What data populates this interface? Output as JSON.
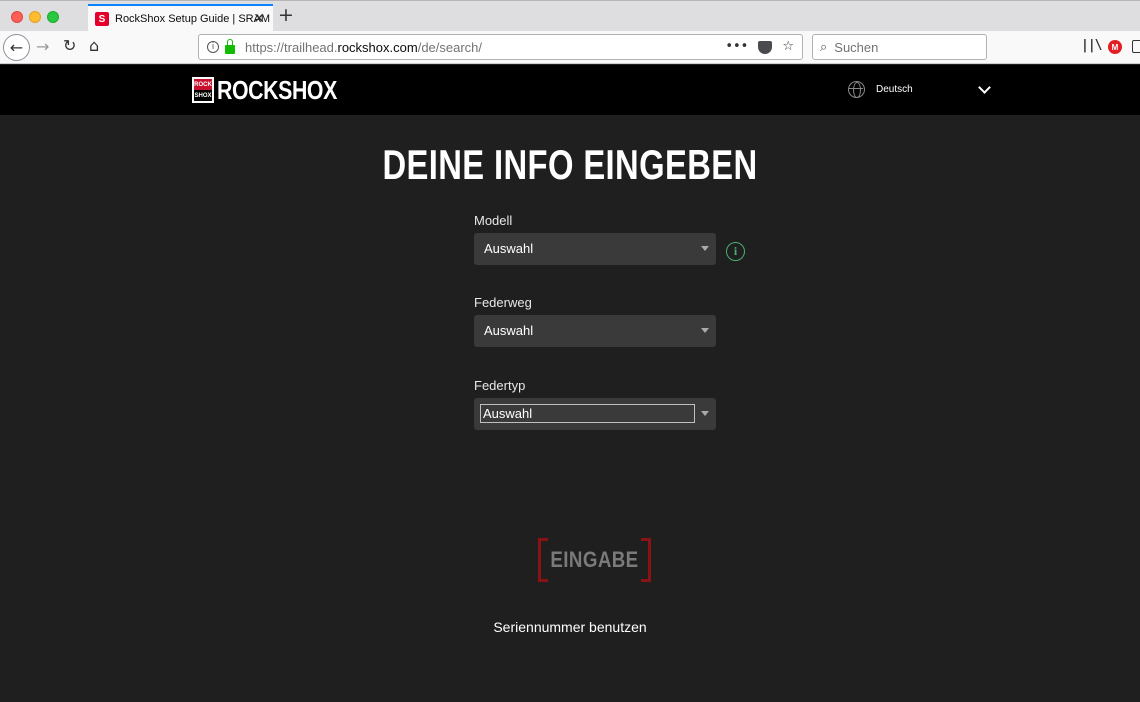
{
  "browser": {
    "tab_title": "RockShox Setup Guide | SRAM",
    "tab_close": "✕",
    "new_tab": "+",
    "favicon_letter": "S",
    "url_prefix": "https://trailhead.",
    "url_host": "rockshox.com",
    "url_path": "/de/search/",
    "search_placeholder": "Suchen",
    "url_actions_more": "•••",
    "bookmark_star": "☆",
    "library_glyph": "||\\",
    "ext_letter": "M"
  },
  "header": {
    "logo_badge_top": "ROCK",
    "logo_badge_bottom": "SHOX",
    "logo_text": "ROCKSHOX",
    "language": "Deutsch"
  },
  "main": {
    "title": "DEINE INFO EINGEBEN",
    "fields": [
      {
        "label": "Modell",
        "value": "Auswahl"
      },
      {
        "label": "Federweg",
        "value": "Auswahl"
      },
      {
        "label": "Federtyp",
        "value": "Auswahl"
      }
    ],
    "info_glyph": "i",
    "submit_label": "EINGABE",
    "serial_link": "Seriennummer benutzen"
  },
  "colors": {
    "accent_red": "#8a1214",
    "info_green": "#4caf70",
    "background": "#1f1f1f",
    "header_bg": "#000000"
  }
}
